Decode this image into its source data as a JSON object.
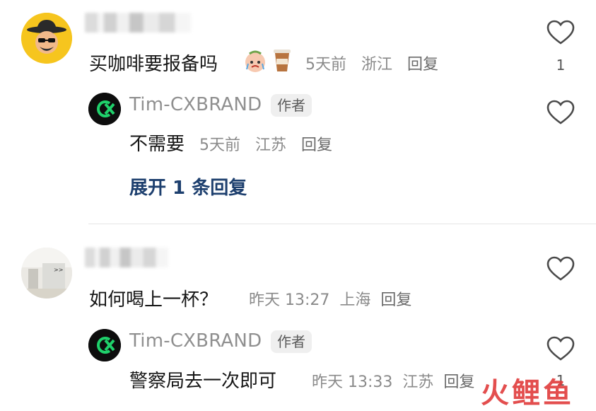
{
  "comments": [
    {
      "user_name": "▇▇▇ ▇▇",
      "text": "买咖啡要报备吗",
      "time": "5天前",
      "location": "浙江",
      "reply_label": "回复",
      "like_count": "1",
      "author_reply": {
        "name": "Tim-CXBRAND",
        "badge": "作者",
        "text": "不需要",
        "time": "5天前",
        "location": "江苏",
        "reply_label": "回复"
      },
      "expand_label": "展开 1 条回复"
    },
    {
      "user_name": "▇▇▇ ▇▇",
      "text": "如何喝上一杯？",
      "time": "昨天 13:27",
      "location": "上海",
      "reply_label": "回复",
      "author_reply": {
        "name": "Tim-CXBRAND",
        "badge": "作者",
        "text": "警察局去一次即可",
        "time": "昨天 13:33",
        "location": "江苏",
        "reply_label": "回复",
        "like_count": "1"
      }
    }
  ],
  "watermark": "火鲤鱼",
  "colors": {
    "brand_green": "#0b7f3a",
    "link_blue": "#1d3f6e",
    "watermark_red": "#e13b3b"
  }
}
